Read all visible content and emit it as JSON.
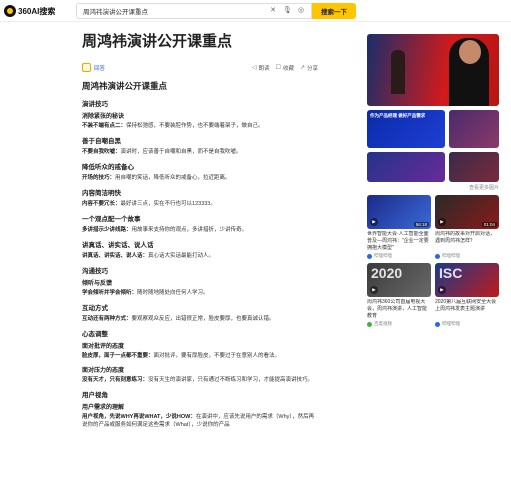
{
  "search": {
    "logo_text": "360AI搜索",
    "query": "周鸿祎演讲公开课重点",
    "button_label": "搜索一下"
  },
  "article": {
    "title": "周鸿祎演讲公开课重点",
    "source_label": "回答",
    "actions": [
      "朗读",
      "收藏",
      "分享"
    ],
    "heading": "周鸿祎演讲公开课重点",
    "sections": [
      {
        "heading": "演讲技巧",
        "items": [
          {
            "sub": "消除紧张的秘诀",
            "lead": "不装不端有点二：",
            "text": "保持松弛感，不要装腔作势，也不要端着架子，做自己。"
          }
        ]
      },
      {
        "heading": "善于自嘲自黑",
        "items": [
          {
            "sub": "",
            "lead": "不要自我吹嘘：",
            "text": "演讲时，应该善于自嘲和自黑，而不是自我吹嘘。"
          }
        ]
      },
      {
        "heading": "降低听众的戒备心",
        "items": [
          {
            "sub": "",
            "lead": "开场的技巧：",
            "text": "用自嘲的笑话，降低听众的戒备心，拉近距离。"
          }
        ]
      },
      {
        "heading": "内容简洁明快",
        "items": [
          {
            "sub": "",
            "lead": "内容不要冗长：",
            "text": "最好讲三点，实在不行也可以123333。"
          }
        ]
      },
      {
        "heading": "一个观点配一个故事",
        "items": [
          {
            "sub": "",
            "lead": "多讲措示少讲线路：",
            "text": "用故事来支持你的观点，多讲措折，少讲传奇。"
          }
        ]
      },
      {
        "heading": "讲真话、讲实话、说人话",
        "items": [
          {
            "sub": "",
            "lead": "讲真话、讲实话、说人话：",
            "text": "真心话大实话最能打动人。"
          }
        ]
      },
      {
        "heading": "沟通技巧",
        "items": [
          {
            "sub": "倾听与反馈",
            "lead": "学会倾听并学会倾听：",
            "text": "随时随地随处向任何人学习。"
          }
        ]
      },
      {
        "heading": "互动方式",
        "items": [
          {
            "sub": "",
            "lead": "互动还有两种方式：",
            "text": "要观察观众反应，出错很正常，脸皮要厚，也要真诚认错。"
          }
        ]
      },
      {
        "heading": "心态调整",
        "items": [
          {
            "sub": "面对批评的态度",
            "lead": "脸皮厚，面子一点都不重要：",
            "text": "面对批评，要有厚脸皮，不要过于在意别人的看法。"
          },
          {
            "sub": "面对压力的态度",
            "lead": "没有天才，只有刻意练习：",
            "text": "没有天生的演讲家，只有通过不断练习和学习，才能提高演讲技巧。"
          }
        ]
      },
      {
        "heading": "用户视角",
        "items": [
          {
            "sub": "用户需求的理解",
            "lead": "用户视角，先说WHY再说WHAT，少说HOW：",
            "text": "在演讲中，应该先说用户的需求（Why），然后再说你的产品或服务如何满足这些需求（What），少说你的产品"
          }
        ]
      }
    ]
  },
  "sidebar": {
    "small_thumbs": [
      {
        "overlay": "作为产品经理 做好产品需求"
      },
      {
        "overlay": ""
      },
      {
        "overlay": ""
      },
      {
        "overlay": ""
      }
    ],
    "more_label": "查看更多图片",
    "cards": [
      {
        "title": "世界智能大会·人工智能全面普及—周鸿祎：\"企业一定要拥抱大模型\"",
        "duration": "56:18",
        "source": "哔哩哔哩"
      },
      {
        "title": "周鸿祎的故事对开启对话，遇到周鸿祎怎样？",
        "duration": "01:04",
        "source": "哔哩哔哩"
      },
      {
        "title": "周鸿祎360公司首届电视大会，周鸿祎演讲，人工智能教育",
        "duration": "",
        "source": "百度视频",
        "big": "2020"
      },
      {
        "title": "2020第八届互联网安全大会上周鸿祎发表主题演讲",
        "duration": "",
        "source": "哔哩哔哩",
        "big": "ISC"
      }
    ]
  }
}
